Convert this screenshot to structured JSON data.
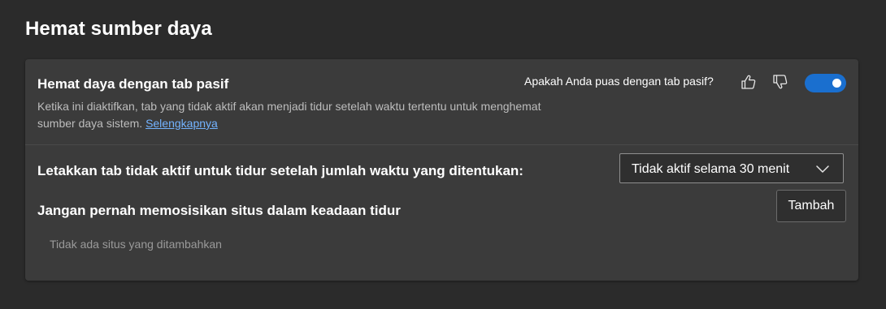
{
  "page": {
    "title": "Hemat sumber daya"
  },
  "sleeping_tabs": {
    "title": "Hemat daya dengan tab pasif",
    "description": "Ketika ini diaktifkan, tab yang tidak aktif akan menjadi tidur setelah waktu tertentu untuk menghemat sumber daya sistem.",
    "learn_more": "Selengkapnya",
    "feedback_question": "Apakah Anda puas dengan tab pasif?",
    "thumbs_up_icon": "thumbs-up-icon",
    "thumbs_down_icon": "thumbs-down-icon",
    "enabled": true,
    "toggle_color": "#1a6fcf"
  },
  "sleep_timeout": {
    "label": "Letakkan tab tidak aktif untuk tidur setelah jumlah waktu yang ditentukan:",
    "selected": "Tidak aktif selama 30 menit",
    "chevron_icon": "chevron-down-icon"
  },
  "never_sleep": {
    "label": "Jangan pernah memosisikan situs dalam keadaan tidur",
    "add_button": "Tambah",
    "empty_message": "Tidak ada situs yang ditambahkan"
  }
}
